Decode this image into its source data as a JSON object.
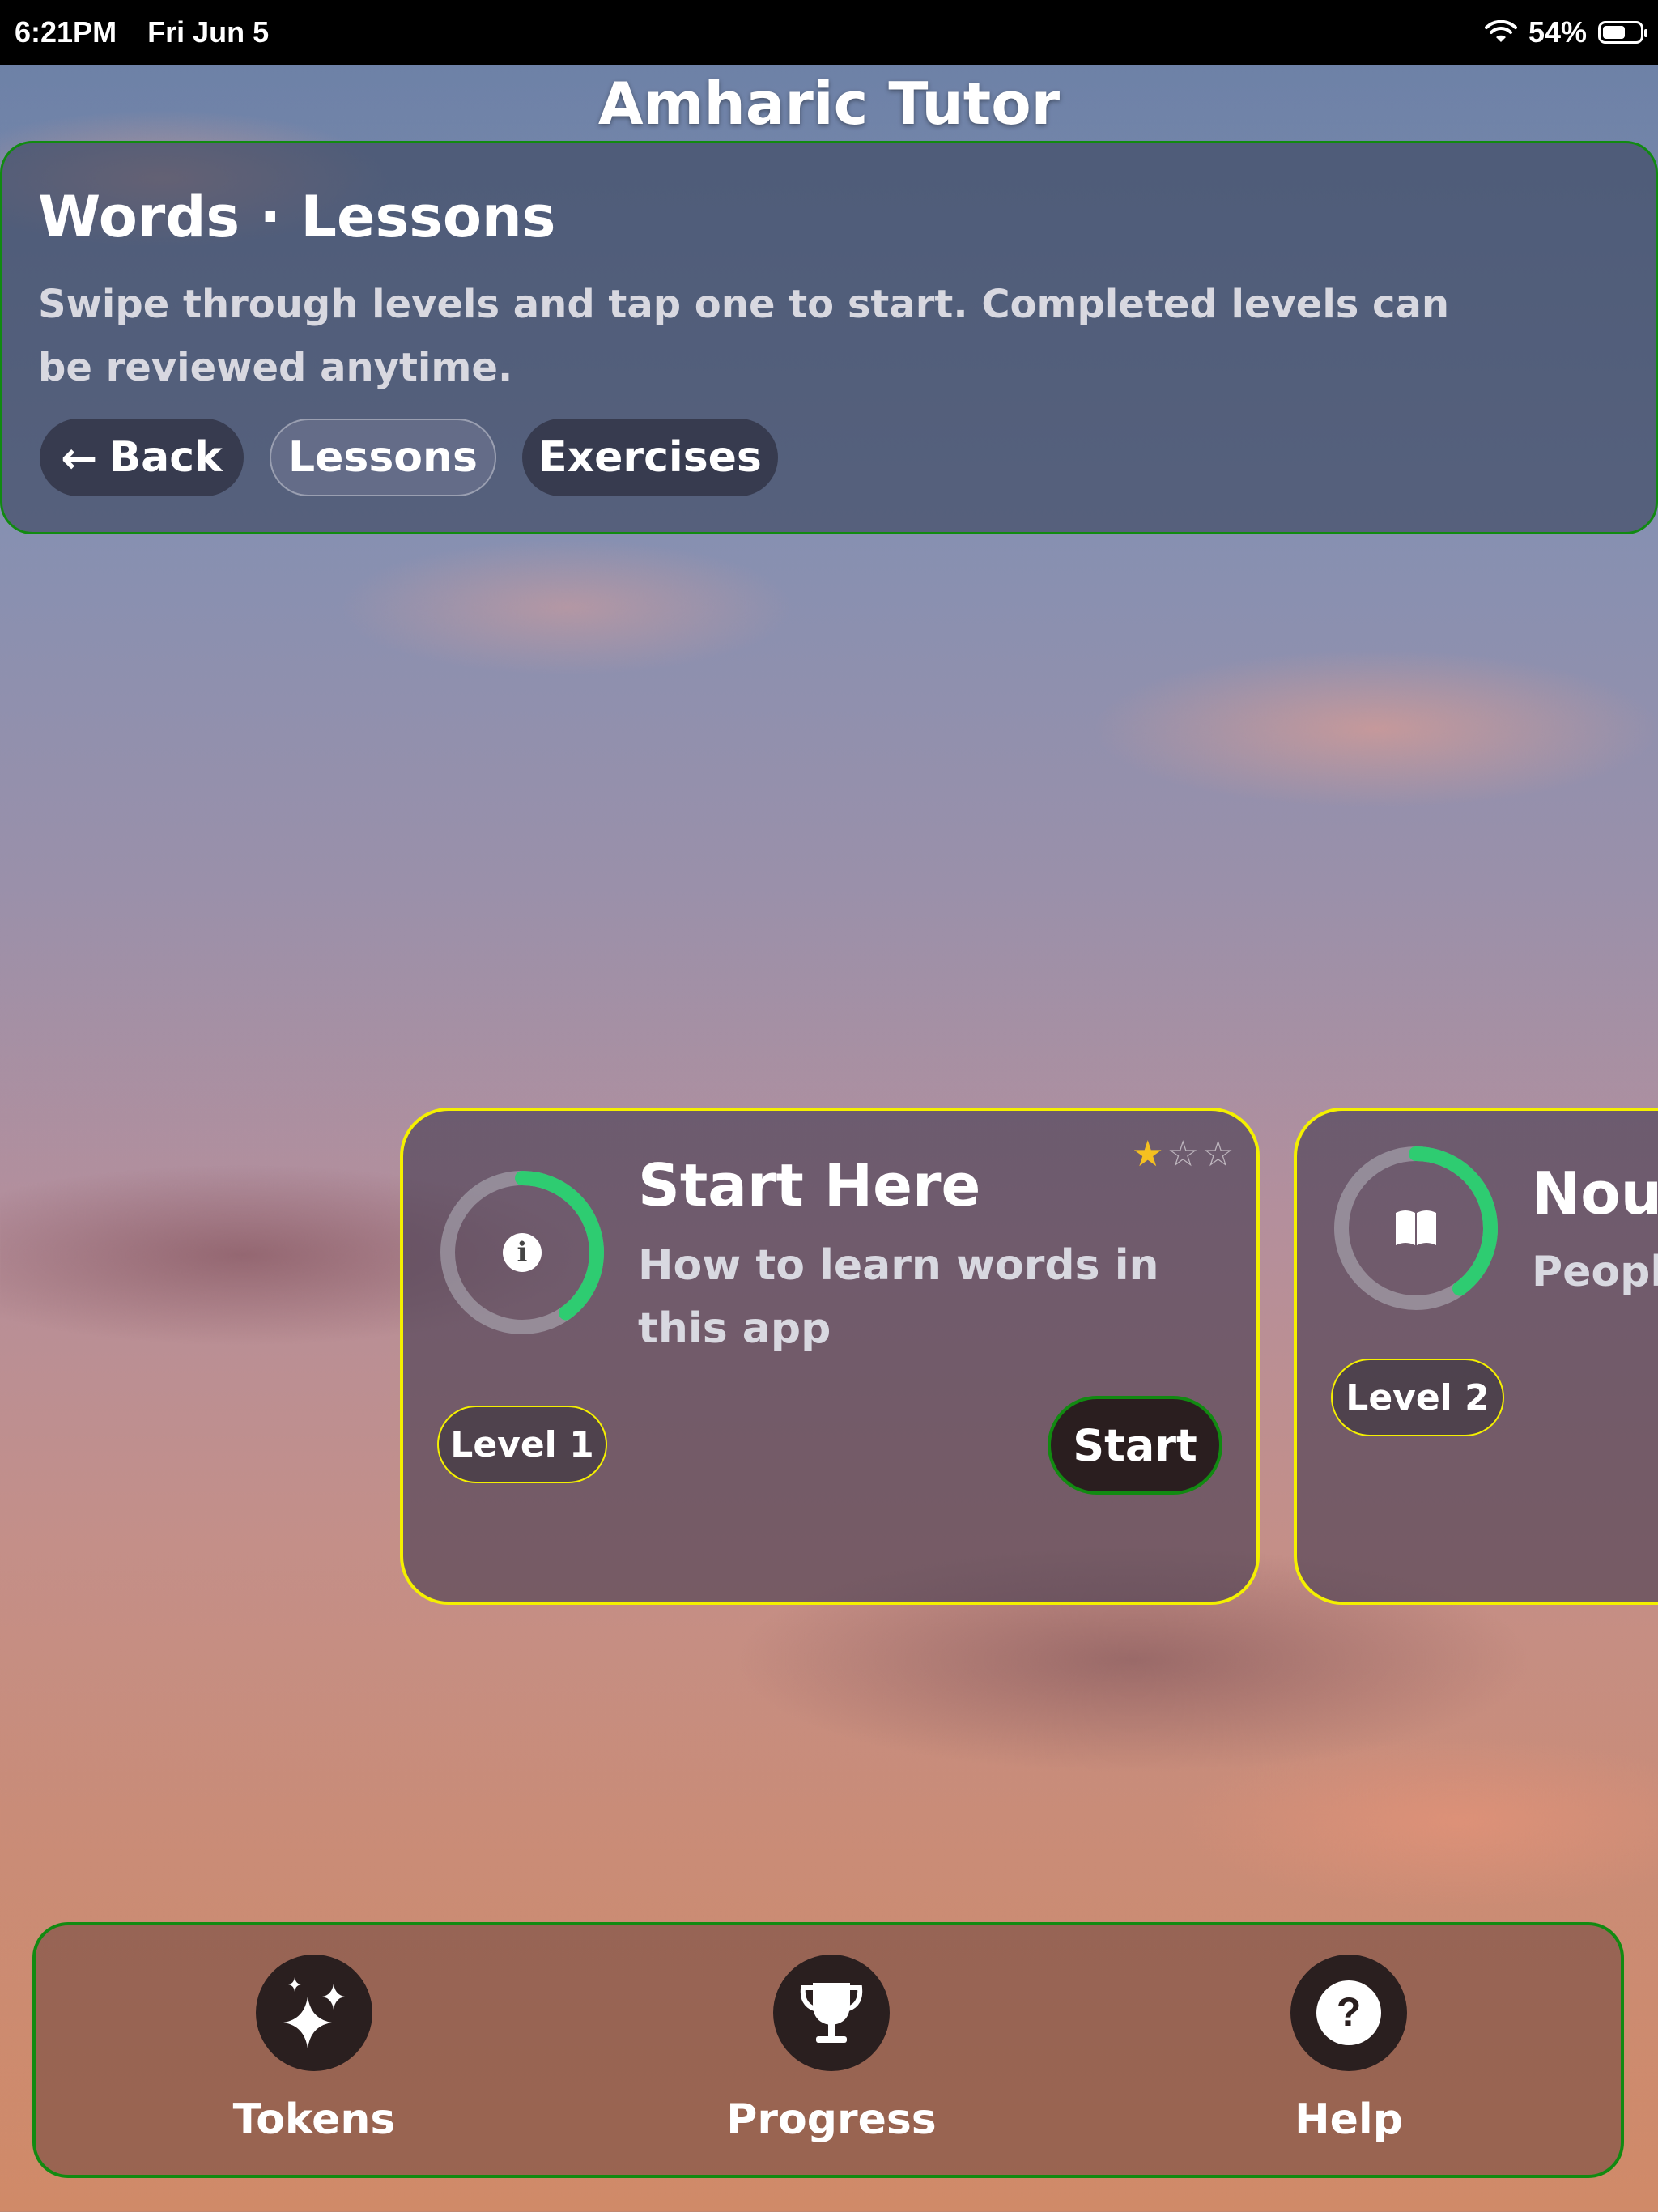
{
  "status_bar": {
    "time": "6:21PM",
    "date": "Fri Jun 5",
    "battery": "54%"
  },
  "app": {
    "title": "Amharic Tutor"
  },
  "header": {
    "title": "Words · Lessons",
    "subtitle": "Swipe through levels and tap one to start. Completed levels can be reviewed anytime.",
    "buttons": {
      "back": "Back",
      "lessons": "Lessons",
      "exercises": "Exercises"
    },
    "active_tab": "Lessons"
  },
  "cards": [
    {
      "title": "Start Here",
      "description": "How to learn words in this app",
      "level": "Level 1",
      "stars_filled": 1,
      "stars_total": 3,
      "progress": 0.4,
      "icon": "info-icon",
      "action": "Start"
    },
    {
      "title": "Nou",
      "description": "People",
      "level": "Level 2",
      "progress": 0.4,
      "icon": "book-icon"
    }
  ],
  "bottom_nav": [
    {
      "label": "Tokens",
      "icon": "sparkles-icon"
    },
    {
      "label": "Progress",
      "icon": "trophy-icon"
    },
    {
      "label": "Help",
      "icon": "help-icon"
    }
  ],
  "colors": {
    "panel_border": "#118a11",
    "card_border": "#f4f000",
    "progress": "#2ecc71",
    "star": "#f5c020"
  }
}
